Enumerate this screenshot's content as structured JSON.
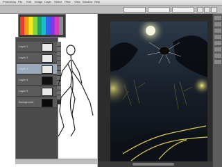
{
  "menubar": {
    "items": [
      "Photoshop",
      "File",
      "Edit",
      "Image",
      "Layer",
      "Select",
      "Filter",
      "View",
      "Window",
      "Help"
    ]
  },
  "toolbar": {
    "field1": "",
    "field2": "",
    "field3": ""
  },
  "layers_panel": {
    "rows": [
      {
        "name": "Layer 1"
      },
      {
        "name": "Layer 2"
      },
      {
        "name": "Layer 3"
      },
      {
        "name": "Layer 4"
      },
      {
        "name": "Layer 5"
      },
      {
        "name": "Background"
      }
    ]
  },
  "status": {
    "text": ""
  },
  "colors": {
    "night_bg": "#141820",
    "moon": "#f2f2d6",
    "glow": "#e7d95a"
  }
}
